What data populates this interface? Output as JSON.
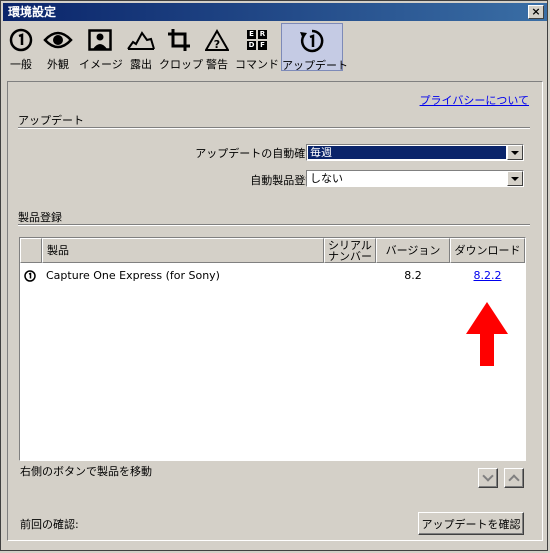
{
  "window": {
    "title": "環境設定",
    "close_label": "×"
  },
  "toolbar": {
    "items": [
      {
        "label": "一般",
        "icon": "info-circle-icon"
      },
      {
        "label": "外観",
        "icon": "eye-icon"
      },
      {
        "label": "イメージ",
        "icon": "portrait-icon"
      },
      {
        "label": "露出",
        "icon": "histogram-icon"
      },
      {
        "label": "クロップ",
        "icon": "crop-icon"
      },
      {
        "label": "警告",
        "icon": "warning-icon"
      },
      {
        "label": "コマンド",
        "icon": "keyboard-icon"
      },
      {
        "label": "アップデート",
        "icon": "update-icon",
        "active": true
      }
    ],
    "keyboard_keys": [
      "E",
      "R",
      "D",
      "F"
    ]
  },
  "privacy_link": "プライバシーについて",
  "update_section": {
    "title": "アップデート",
    "auto_check_label": "アップデートの自動確認:",
    "auto_check_value": "毎週",
    "auto_register_label": "自動製品登録:",
    "auto_register_value": "しない"
  },
  "registration_section": {
    "title": "製品登録",
    "columns": {
      "product": "製品",
      "serial_line1": "シリアル",
      "serial_line2": "ナンバー",
      "version": "バージョン",
      "download": "ダウンロード"
    },
    "rows": [
      {
        "product": "Capture One Express (for Sony)",
        "serial": "",
        "version": "8.2",
        "download": "8.2.2"
      }
    ],
    "hint": "右側のボタンで製品を移動"
  },
  "footer": {
    "last_check_label": "前回の確認:",
    "check_button": "アップデートを確認"
  },
  "colors": {
    "active_tab": "#c5cbe4",
    "arrow": "#ff0000",
    "titlebar": "#0a246a",
    "selection": "#0a246a"
  }
}
